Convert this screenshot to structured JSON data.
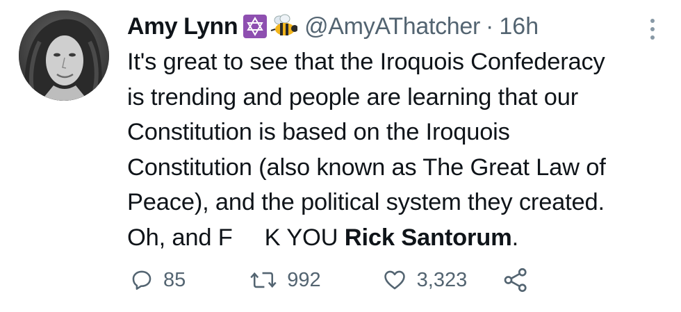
{
  "author": {
    "name": "Amy Lynn",
    "handle": "@AmyAThatcher",
    "separator": "·",
    "time": "16h"
  },
  "icons": {
    "star_emoji": "star-of-david-emoji",
    "bee_emoji": "bee-emoji",
    "more": "more-vertical-icon"
  },
  "body": {
    "text_main": "It's great to see that the Iroquois Confederacy\nis trending and people are learning that our\nConstitution is based on the Iroquois\nConstitution (also known as The Great Law of\nPeace), and the political system they created.\n",
    "text_oh": "Oh, and F",
    "text_k": "K YOU ",
    "mention": "Rick Santorum",
    "period": "."
  },
  "actions": {
    "replies": "85",
    "retweets": "992",
    "likes": "3,323"
  },
  "colors": {
    "text": "#0f1419",
    "secondary": "#536471",
    "emoji_purple": "#8e4fb0"
  }
}
